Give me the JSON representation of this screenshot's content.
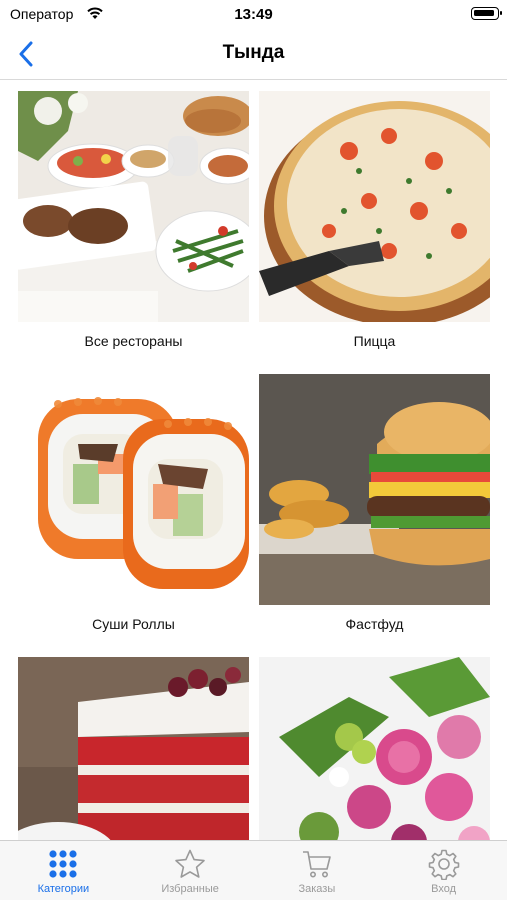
{
  "status_bar": {
    "carrier": "Оператор",
    "time": "13:49"
  },
  "nav": {
    "title": "Тында"
  },
  "categories": [
    {
      "label": "Все рестораны"
    },
    {
      "label": "Пицца"
    },
    {
      "label": "Суши Роллы"
    },
    {
      "label": "Фастфуд"
    },
    {
      "label": ""
    },
    {
      "label": ""
    }
  ],
  "tabs": [
    {
      "label": "Категории",
      "icon": "grid-dots-icon",
      "active": true
    },
    {
      "label": "Избранные",
      "icon": "star-icon",
      "active": false
    },
    {
      "label": "Заказы",
      "icon": "cart-icon",
      "active": false
    },
    {
      "label": "Вход",
      "icon": "gear-icon",
      "active": false
    }
  ],
  "colors": {
    "accent": "#1a6fe8",
    "inactive": "#9a9a9a"
  }
}
